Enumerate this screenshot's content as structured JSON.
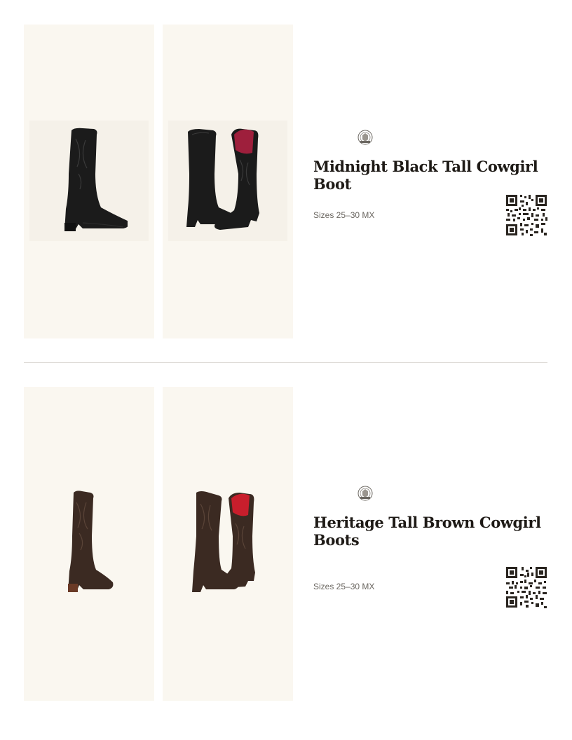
{
  "products": [
    {
      "title": "Midnight Black Tall Cowgirl Boot",
      "sizes": "Sizes 25–30 MX",
      "color": "#1b1b1b",
      "accent": "#9e1f3c",
      "image_front": "black tall cowgirl boot side view",
      "image_pair": "pair of black tall cowgirl boots with pink lining"
    },
    {
      "title": "Heritage Tall Brown Cowgirl Boots",
      "sizes": "Sizes 25–30 MX",
      "color": "#3b2a22",
      "accent": "#c81e2c",
      "image_front": "brown tall cowgirl boot side view",
      "image_pair": "pair of brown tall cowgirl boots with red lining"
    }
  ],
  "icons": {
    "brand_logo": "brand-crest-icon",
    "qr": "qr-code-icon"
  }
}
